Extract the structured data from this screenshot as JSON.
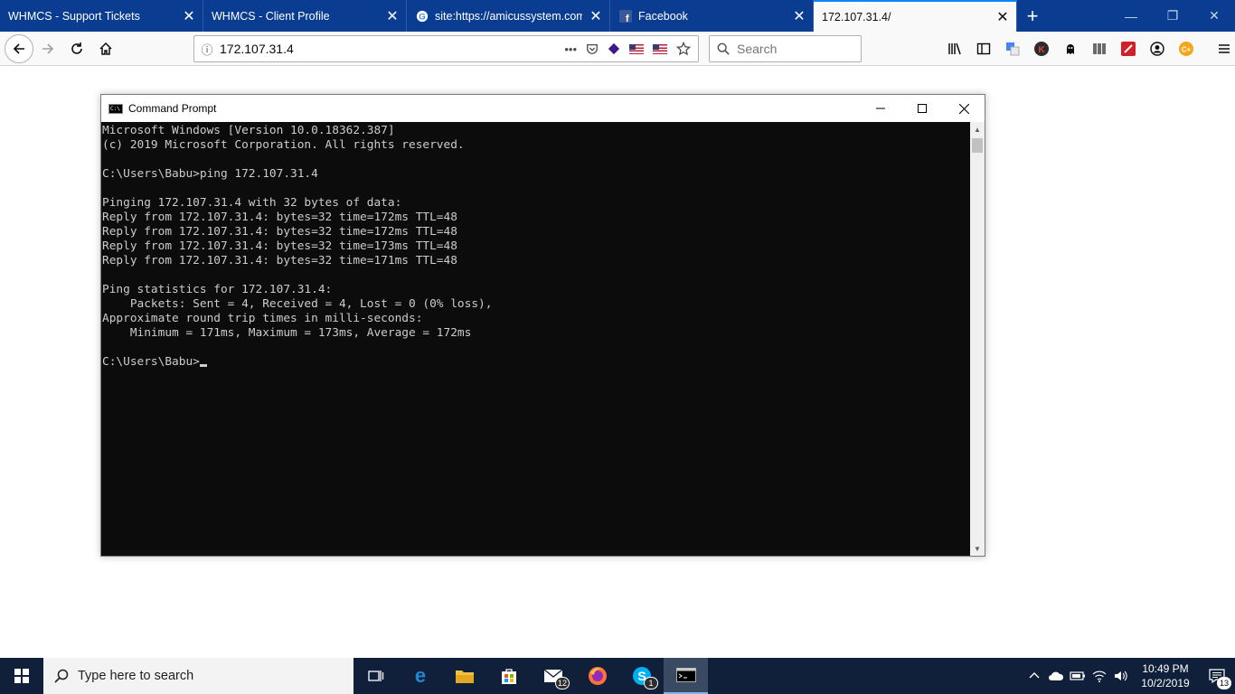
{
  "browser": {
    "tabs": [
      {
        "label": "WHMCS - Support Tickets",
        "close": "✕"
      },
      {
        "label": "WHMCS - Client Profile",
        "close": "✕"
      },
      {
        "label": "site:https://amicussystem.com",
        "close": "✕"
      },
      {
        "label": "Facebook",
        "close": "✕"
      },
      {
        "label": "172.107.31.4/",
        "close": "✕"
      }
    ],
    "new_tab": "+",
    "url": "172.107.31.4",
    "search_placeholder": "Search",
    "page_actions": "•••"
  },
  "cmd": {
    "title": "Command Prompt",
    "lines": [
      "Microsoft Windows [Version 10.0.18362.387]",
      "(c) 2019 Microsoft Corporation. All rights reserved.",
      "",
      "C:\\Users\\Babu>ping 172.107.31.4",
      "",
      "Pinging 172.107.31.4 with 32 bytes of data:",
      "Reply from 172.107.31.4: bytes=32 time=172ms TTL=48",
      "Reply from 172.107.31.4: bytes=32 time=172ms TTL=48",
      "Reply from 172.107.31.4: bytes=32 time=173ms TTL=48",
      "Reply from 172.107.31.4: bytes=32 time=171ms TTL=48",
      "",
      "Ping statistics for 172.107.31.4:",
      "    Packets: Sent = 4, Received = 4, Lost = 0 (0% loss),",
      "Approximate round trip times in milli-seconds:",
      "    Minimum = 171ms, Maximum = 173ms, Average = 172ms",
      "",
      "C:\\Users\\Babu>"
    ]
  },
  "taskbar": {
    "search_text": "Type here to search",
    "mail_badge": "12",
    "skype_badge": "1",
    "clock_time": "10:49 PM",
    "clock_date": "10/2/2019",
    "notification_count": "13"
  },
  "colors": {
    "tabstrip": "#0a3d91",
    "terminal_bg": "#0c0c0c",
    "terminal_text": "#cccccc",
    "taskbar": "#10203a"
  }
}
